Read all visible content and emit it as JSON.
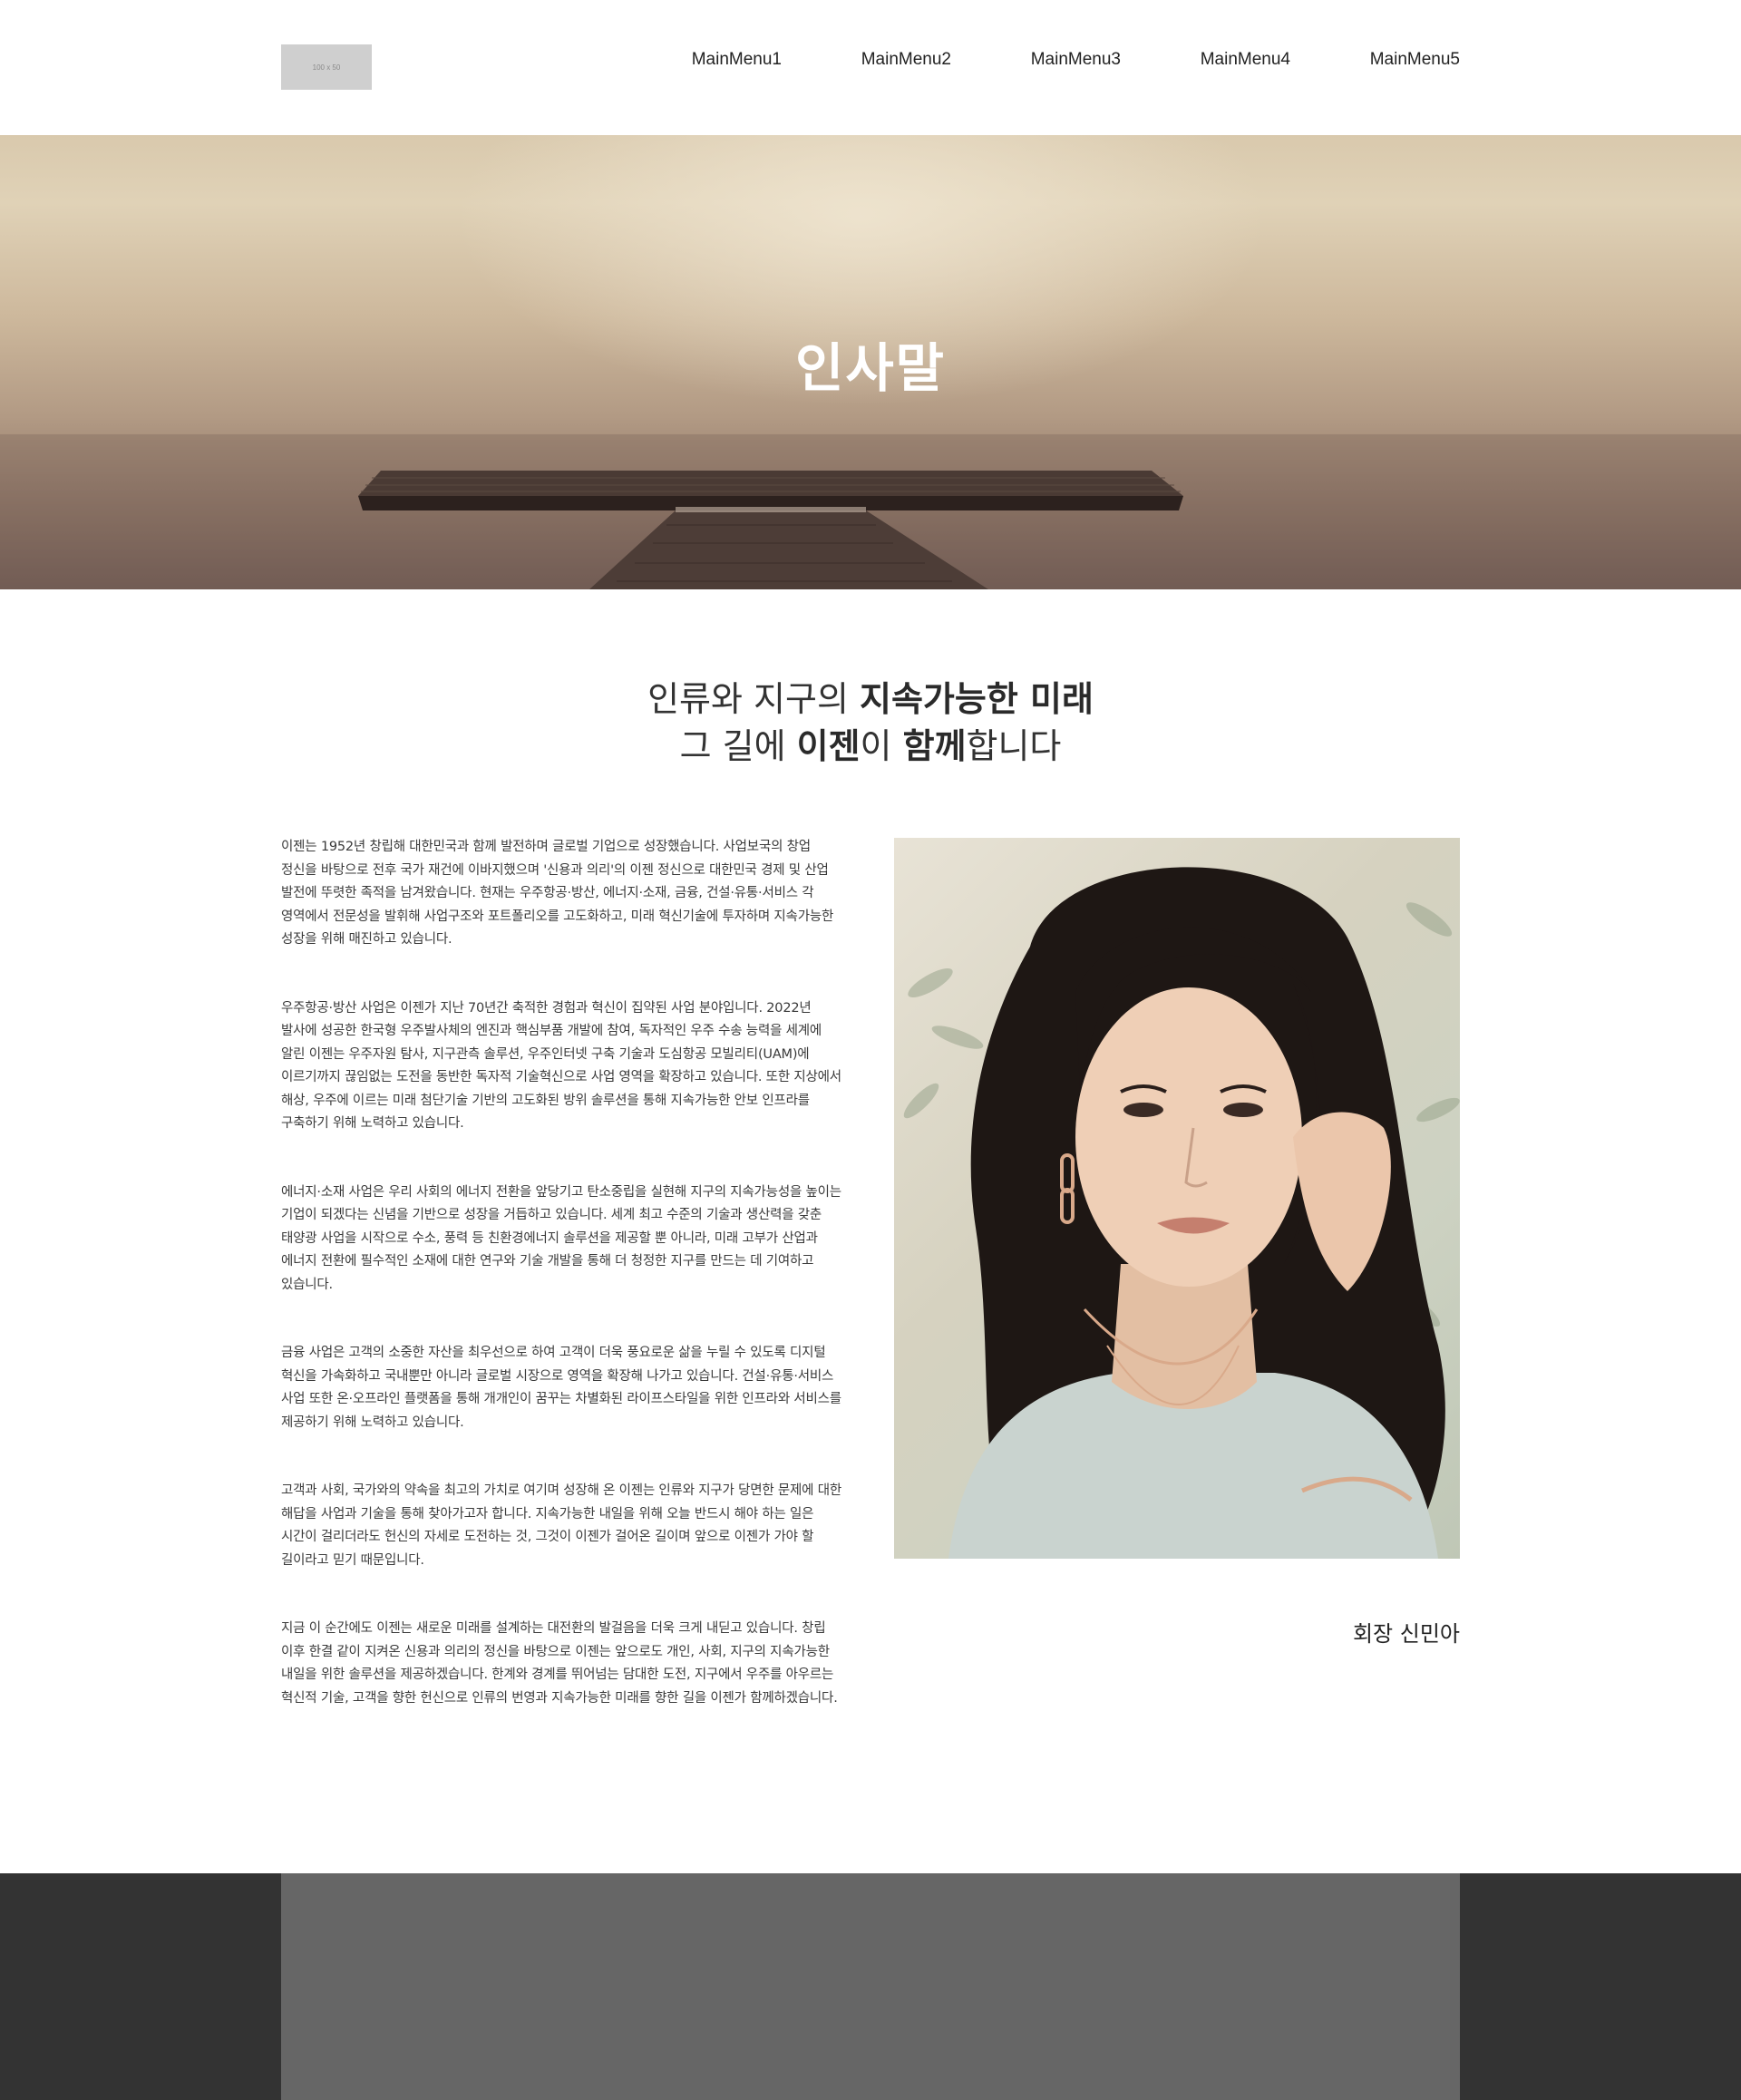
{
  "header": {
    "logo_text": "100 x 50",
    "menu": [
      "MainMenu1",
      "MainMenu2",
      "MainMenu3",
      "MainMenu4",
      "MainMenu5"
    ]
  },
  "hero": {
    "title": "인사말"
  },
  "intro": {
    "line1_normal": "인류와 지구의 ",
    "line1_bold": "지속가능한 미래",
    "line2_a": "그 길에 ",
    "line2_b": "이젠",
    "line2_c": "이 ",
    "line2_d": "함께",
    "line2_e": "합니다"
  },
  "paragraphs": [
    "이젠는 1952년 창립해 대한민국과 함께 발전하며 글로벌 기업으로 성장했습니다. 사업보국의 창업 정신을 바탕으로 전후 국가 재건에 이바지했으며 '신용과 의리'의 이젠 정신으로 대한민국 경제 및 산업 발전에 뚜렷한 족적을 남겨왔습니다. 현재는 우주항공·방산, 에너지·소재, 금융, 건설·유통·서비스 각 영역에서 전문성을 발휘해 사업구조와 포트폴리오를 고도화하고, 미래 혁신기술에 투자하며 지속가능한 성장을 위해 매진하고 있습니다.",
    "우주항공·방산 사업은 이젠가 지난 70년간 축적한 경험과 혁신이 집약된 사업 분야입니다. 2022년 발사에 성공한 한국형 우주발사체의 엔진과 핵심부품 개발에 참여, 독자적인 우주 수송 능력을 세계에 알린 이젠는 우주자원 탐사, 지구관측 솔루션, 우주인터넷 구축 기술과 도심항공 모빌리티(UAM)에 이르기까지 끊임없는 도전을 동반한 독자적 기술혁신으로 사업 영역을 확장하고 있습니다. 또한 지상에서 해상, 우주에 이르는 미래 첨단기술 기반의 고도화된 방위 솔루션을 통해 지속가능한 안보 인프라를 구축하기 위해 노력하고 있습니다.",
    "에너지·소재 사업은 우리 사회의 에너지 전환을 앞당기고 탄소중립을 실현해 지구의 지속가능성을 높이는 기업이 되겠다는 신념을 기반으로 성장을 거듭하고 있습니다. 세계 최고 수준의 기술과 생산력을 갖춘 태양광 사업을 시작으로 수소, 풍력 등 친환경에너지 솔루션을 제공할 뿐 아니라, 미래 고부가 산업과 에너지 전환에 필수적인 소재에 대한 연구와 기술 개발을 통해 더 청정한 지구를 만드는 데 기여하고 있습니다.",
    "금융 사업은 고객의 소중한 자산을 최우선으로 하여 고객이 더욱 풍요로운 삶을 누릴 수 있도록 디지털 혁신을 가속화하고 국내뿐만 아니라 글로벌 시장으로 영역을 확장해 나가고 있습니다. 건설·유통·서비스 사업 또한 온·오프라인 플랫폼을 통해 개개인이 꿈꾸는 차별화된 라이프스타일을 위한 인프라와 서비스를 제공하기 위해 노력하고 있습니다.",
    "고객과 사회, 국가와의 약속을 최고의 가치로 여기며 성장해 온 이젠는 인류와 지구가 당면한 문제에 대한 해답을 사업과 기술을 통해 찾아가고자 합니다. 지속가능한 내일을 위해 오늘 반드시 해야 하는 일은 시간이 걸리더라도 헌신의 자세로 도전하는 것, 그것이 이젠가 걸어온 길이며 앞으로 이젠가 가야 할 길이라고 믿기 때문입니다.",
    "지금 이 순간에도 이젠는 새로운 미래를 설계하는 대전환의 발걸음을 더욱 크게 내딛고 있습니다. 창립 이후 한결 같이 지켜온 신용과 의리의 정신을 바탕으로 이젠는 앞으로도 개인, 사회, 지구의 지속가능한 내일을 위한 솔루션을 제공하겠습니다. 한계와 경계를 뛰어넘는 담대한 도전, 지구에서 우주를 아우르는 혁신적 기술, 고객을 향한 헌신으로 인류의 번영과 지속가능한 미래를 향한 길을 이젠가 함께하겠습니다."
  ],
  "signature": "회장 신민아",
  "colors": {
    "footer_outer": "#333333",
    "footer_inner": "#666666",
    "text": "#3a3a3a",
    "logo_placeholder": "#cfcfcf"
  }
}
